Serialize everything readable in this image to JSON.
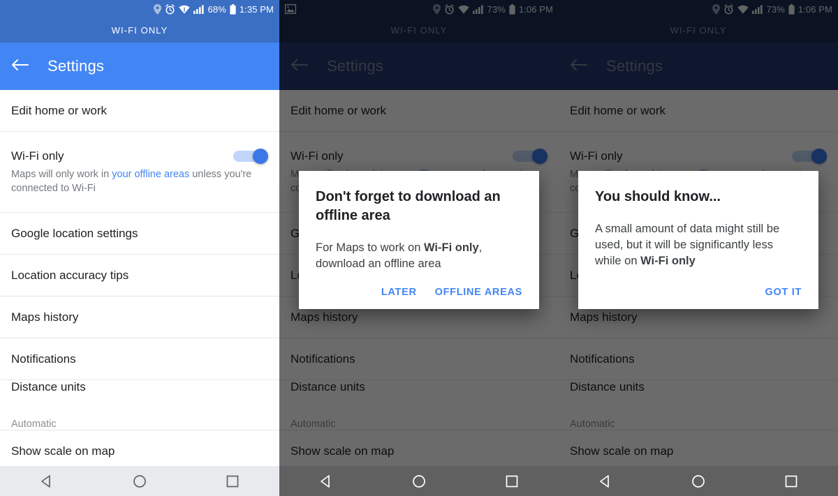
{
  "panels": [
    {
      "id": "panel-settings",
      "theme": "light",
      "statusbar": {
        "battery_percent": "68%",
        "time": "1:35 PM",
        "icons": [
          "location-pin-icon",
          "alarm-icon",
          "wifi-icon",
          "cell-signal-icon",
          "battery-icon"
        ]
      },
      "wifi_banner": "WI-FI ONLY",
      "appbar": {
        "title": "Settings",
        "back": "back-arrow-icon"
      }
    },
    {
      "id": "panel-offline-dialog",
      "theme": "dark",
      "statusbar": {
        "battery_percent": "73%",
        "time": "1:06 PM",
        "notification_icon": "image-icon",
        "icons": [
          "location-pin-icon",
          "alarm-icon",
          "wifi-icon",
          "cell-signal-icon",
          "battery-icon"
        ]
      },
      "wifi_banner": "WI-FI ONLY",
      "appbar": {
        "title": "Settings",
        "back": "back-arrow-icon"
      }
    },
    {
      "id": "panel-know-dialog",
      "theme": "dark",
      "statusbar": {
        "battery_percent": "73%",
        "time": "1:06 PM",
        "icons": [
          "location-pin-icon",
          "alarm-icon",
          "wifi-icon",
          "cell-signal-icon",
          "battery-icon"
        ]
      },
      "wifi_banner": "WI-FI ONLY",
      "appbar": {
        "title": "Settings",
        "back": "back-arrow-icon"
      }
    }
  ],
  "settings_list": {
    "items": [
      {
        "title": "Edit home or work"
      },
      {
        "title": "Wi-Fi only",
        "toggle": "on",
        "description_pre": "Maps will only work in ",
        "description_link": "your offline areas",
        "description_post": " unless you're connected to Wi-Fi"
      },
      {
        "title": "Google location settings"
      },
      {
        "title": "Location accuracy tips"
      },
      {
        "title": "Maps history"
      },
      {
        "title": "Notifications"
      },
      {
        "title": "Distance units",
        "value": "Automatic"
      },
      {
        "title": "Show scale on map"
      }
    ]
  },
  "dialogs": {
    "offline": {
      "title": "Don't forget to download an offline area",
      "body_pre": "For Maps to work on ",
      "body_bold": "Wi-Fi only",
      "body_post": ", download an offline area",
      "buttons": {
        "secondary": "LATER",
        "primary": "OFFLINE AREAS"
      }
    },
    "know": {
      "title": "You should know...",
      "body_pre": "A small amount of data might still be used, but it will be significantly less while on ",
      "body_bold": "Wi-Fi only",
      "body_post": "",
      "buttons": {
        "primary": "GOT IT"
      }
    }
  },
  "navbar": {
    "back": "nav-back-triangle-icon",
    "home": "nav-home-circle-icon",
    "recents": "nav-recents-square-icon"
  },
  "colors": {
    "accent_blue": "#4285f4",
    "appbar_blue": "#4285f4",
    "statusbar_blue": "#3b6fc4",
    "dim_appbar": "#23386b",
    "dim_statusbar": "#1c2e55",
    "link_blue": "#4285f4",
    "navbar_light": "#e8eaed",
    "navbar_dark": "#606060"
  }
}
